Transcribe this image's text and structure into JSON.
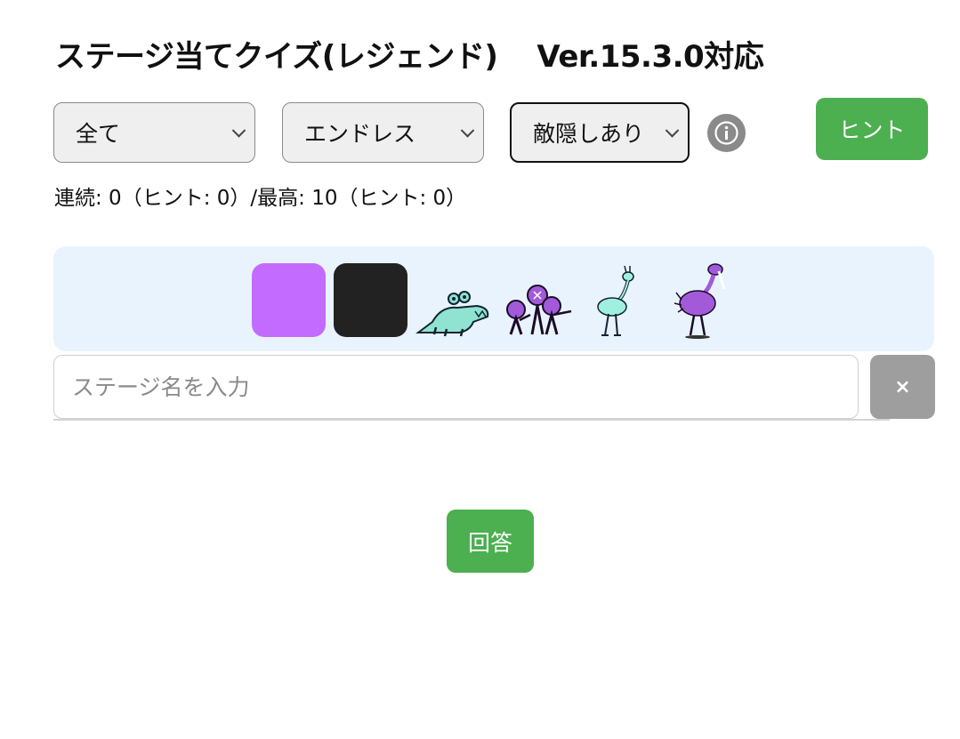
{
  "header": {
    "title": "ステージ当てクイズ(レジェンド)",
    "version": "Ver.15.3.0対応"
  },
  "filters": {
    "category_select": {
      "value": "全て"
    },
    "mode_select": {
      "value": "エンドレス"
    },
    "enemy_select": {
      "value": "敵隠しあり"
    }
  },
  "info_icon": "info-icon",
  "hint_button": {
    "label": "ヒント"
  },
  "stats": {
    "streak_text": "連続: 0（ヒント: 0）/最高: 10（ヒント: 0）"
  },
  "enemy_icons": [
    {
      "name": "purple-swatch",
      "color": "#c36bff"
    },
    {
      "name": "black-swatch",
      "color": "#222222"
    },
    {
      "name": "crocodile-enemy-icon"
    },
    {
      "name": "purple-group-enemy-icon"
    },
    {
      "name": "teal-ostrich-enemy-icon"
    },
    {
      "name": "purple-ostrich-enemy-icon"
    }
  ],
  "answer_input": {
    "placeholder": "ステージ名を入力",
    "value": ""
  },
  "clear_button": {
    "label": "×"
  },
  "answer_button": {
    "label": "回答"
  },
  "colors": {
    "accent_green": "#4caf50",
    "panel_bg": "#e8f3fd",
    "clear_gray": "#9e9e9e"
  }
}
